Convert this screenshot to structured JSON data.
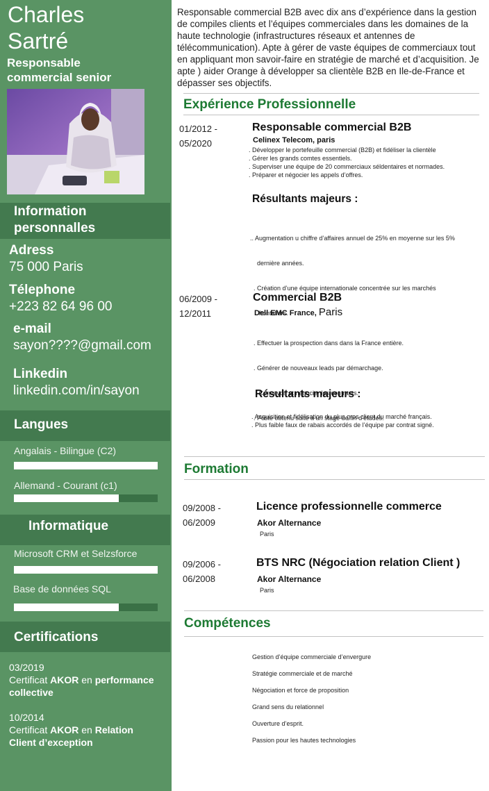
{
  "header": {
    "first_name": "Charles",
    "last_name": "Sartré",
    "role_line1": "Responsable",
    "role_line2": "commercial senior"
  },
  "personal": {
    "heading_line1": "Information",
    "heading_line2": "personnalles",
    "address_label": "Adress",
    "address_value": "75 000 Paris",
    "phone_label": "Télephone",
    "phone_value": "+223 82 64 96 00",
    "email_label": "e-mail",
    "email_value": "sayon????@gmail.com",
    "linkedin_label": "Linkedin",
    "linkedin_value": "linkedin.com/in/sayon"
  },
  "languages": {
    "heading": "Langues",
    "items": [
      {
        "label": "Angalais - Bilingue (C2)",
        "level": 1.0
      },
      {
        "label": "Allemand  - Courant (c1)",
        "level": 0.73
      }
    ]
  },
  "computing": {
    "heading": "Informatique",
    "items": [
      {
        "label": "Microsoft CRM et Selzsforce",
        "level": 1.0
      },
      {
        "label": "Base de données SQL",
        "level": 0.73
      }
    ]
  },
  "certifications": {
    "heading": "Certifications",
    "items": [
      {
        "date": "03/2019",
        "prefix": "Certificat ",
        "org": "AKOR",
        "mid": " en ",
        "topic_a": "performance",
        "topic_b": "collective"
      },
      {
        "date": "10/2014",
        "prefix": "Certificat ",
        "org": "AKOR",
        "mid": " en ",
        "topic_a": "Relation",
        "topic_b": "Client d’exception"
      }
    ]
  },
  "summary": "Responsable commercial B2B avec dix ans d’expérience dans la gestion de compiles clients et l’équipes commerciales dans les domaines de la haute technologie (infrastructures réseaux et antennes de télécommunication). Apte à gérer de vaste équipes de commerciaux tout en appliquant mon savoir-faire en stratégie de marché et d’acquisition. Je apte ) aider Orange à développer sa clientèle B2B en Ile-de-France et dépasser ses objectifs.",
  "experience": {
    "heading": "Expérience Professionnelle",
    "jobs": [
      {
        "date_start": "01/2012 -",
        "date_end": "05/2020",
        "title": "Responsable commercial B2B",
        "company": "Celinex Telecom, paris",
        "company_place": "",
        "tasks": [
          ".  Développer le portefeuille commercial (B2B) et fidéliser la clientèle",
          ".  Gérer les grands comtes essentiels.",
          ".  Superviser une équipe de 20 commerciaux séldentaires et normades.",
          ".  Préparer et négocier les appels d’offres."
        ],
        "results_heading": "Résultants majeurs :",
        "results": [
          ".. Augmentation u chiffre d’affaires annuel de 25% en moyenne sur les 5%",
          "    dernière années.",
          "  . Création d’une équipe internationale concentrée sur les marchés",
          "     frontaliers."
        ]
      },
      {
        "date_start": "06/2009 -",
        "date_end": "12/2011",
        "title": "Commercial B2B",
        "company": "Dell EMC France, ",
        "company_place": "Paris",
        "tasks": [
          ".  Effectuer la prospection dans dans la France entière.",
          ". Générer de nouveaux leads par démarchage.",
          " . Convevoir et négocier les contrants.",
          ". Poste obtenu suite à un stage de fin d’études."
        ],
        "results_heading": "Résultants majeurs :",
        "results": [
          ". Acquisition et fidélisation du plus gros client du marché français.",
          ". Plus faible faux de rabais accordés de l’équipe par contrat signé."
        ]
      }
    ]
  },
  "education": {
    "heading": "Formation",
    "items": [
      {
        "date_start": "09/2008 -",
        "date_end": "06/2009",
        "title": "Licence professionnelle commerce",
        "school": "Akor Alternance",
        "city": "Paris"
      },
      {
        "date_start": "09/2006 -",
        "date_end": "06/2008",
        "title": "BTS NRC (Négociation relation Client )",
        "school": "Akor Alternance",
        "city": "Paris"
      }
    ]
  },
  "skills": {
    "heading": "Compétences",
    "items": [
      "Gestion d’équipe commerciale d’envergure",
      "Stratégie commerciale et de marché",
      "Négociation et force de proposition",
      "Grand sens du relationnel",
      "Ouverture d’esprit.",
      "Passion pour les hautes technologies"
    ]
  },
  "colors": {
    "sidebar": "#5a9464",
    "band": "#437a4f",
    "accent": "#1d7a33"
  }
}
